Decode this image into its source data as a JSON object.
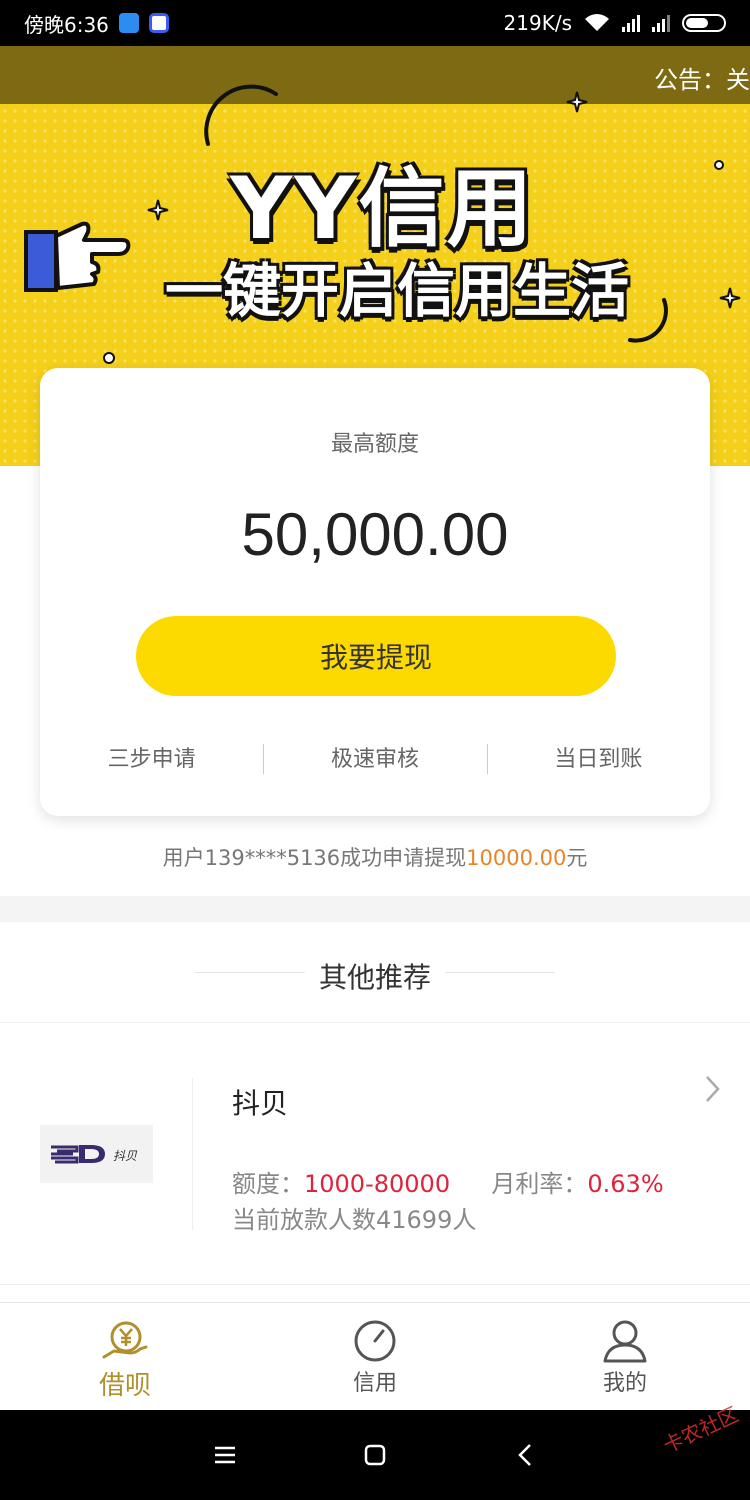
{
  "status_bar": {
    "time": "傍晚6:36",
    "net_speed": "219K/s"
  },
  "banner": {
    "notice": "公告：关",
    "logo_text": "YY信用",
    "slogan": "一键开启信用生活",
    "bg_color": "#f5d01a"
  },
  "card": {
    "label": "最高额度",
    "amount": "50,000.00",
    "button_label": "我要提现",
    "features": [
      "三步申请",
      "极速审核",
      "当日到账"
    ]
  },
  "ticker": {
    "prefix": "用户139****5136成功申请提现",
    "amount": "10000.00",
    "suffix": "元"
  },
  "recommend": {
    "title": "其他推荐",
    "items": [
      {
        "name": "抖贝",
        "logo_text": "抖贝",
        "quota_label": "额度：",
        "quota_value": "1000-80000",
        "rate_label": "月利率：",
        "rate_value": "0.63%",
        "count_text": "当前放款人数41699人"
      }
    ]
  },
  "tabbar": {
    "tabs": [
      {
        "label": "借呗",
        "icon": "yen-hand-icon",
        "active": true
      },
      {
        "label": "信用",
        "icon": "gauge-icon",
        "active": false
      },
      {
        "label": "我的",
        "icon": "user-icon",
        "active": false
      }
    ]
  },
  "colors": {
    "accent_yellow": "#fcda00",
    "active_tab": "#b0902c",
    "highlight_red": "#e0223a",
    "highlight_orange": "#e8842a"
  },
  "watermark": "卡农社区"
}
